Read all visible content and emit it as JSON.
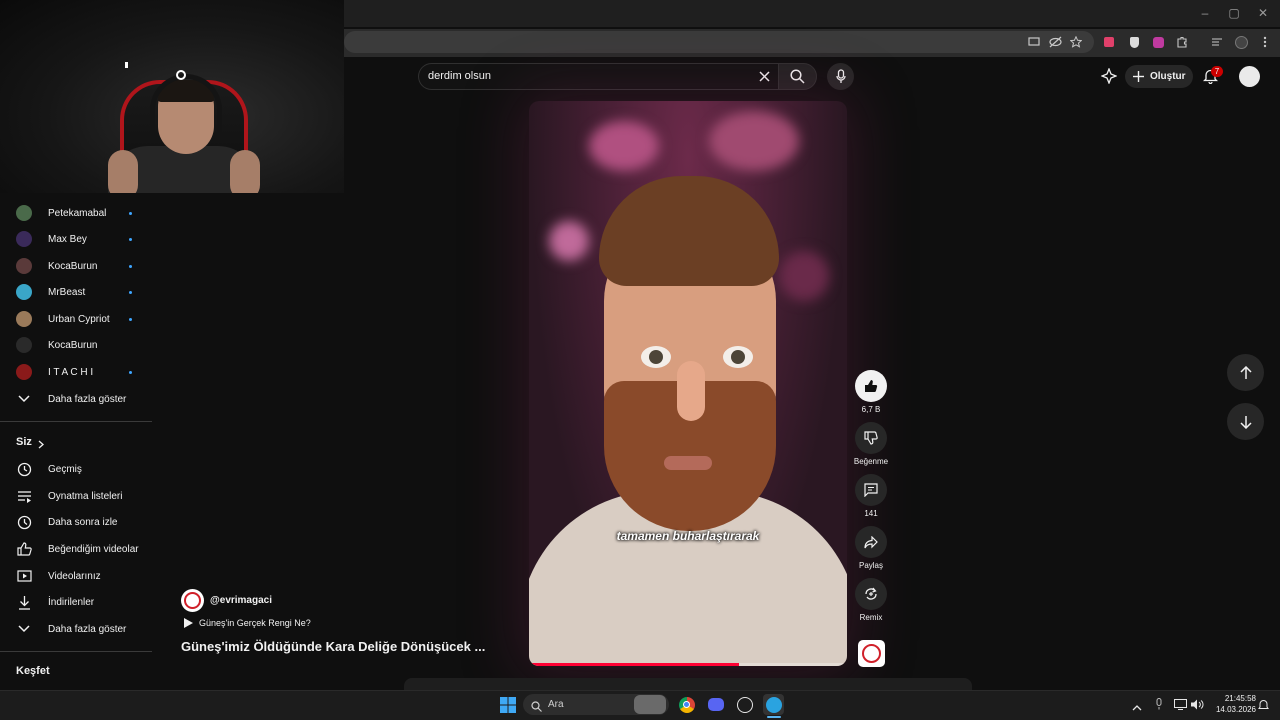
{
  "search": {
    "query": "derdim olsun"
  },
  "header": {
    "create_label": "Oluştur",
    "notification_count": "7"
  },
  "sidebar": {
    "subscriptions": [
      {
        "name": "Petekamabal",
        "avatar_color": "#4a6a4a",
        "new": true
      },
      {
        "name": "Max Bey",
        "avatar_color": "#3a2a5a",
        "new": true
      },
      {
        "name": "KocaBurun",
        "avatar_color": "#5a3a3a",
        "new": true
      },
      {
        "name": "MrBeast",
        "avatar_color": "#3aa6c8",
        "new": true
      },
      {
        "name": "Urban Cypriot",
        "avatar_color": "#9a7a5a",
        "new": true
      },
      {
        "name": "KocaBurun",
        "avatar_color": "#2a2a2a",
        "new": false
      },
      {
        "name": "I T A C H I",
        "avatar_color": "#8a1a1a",
        "new": true
      }
    ],
    "show_more_1": "Daha fazla göster",
    "you_section": "Siz",
    "you_items": [
      {
        "label": "Geçmiş",
        "icon": "history-icon"
      },
      {
        "label": "Oynatma listeleri",
        "icon": "playlists-icon"
      },
      {
        "label": "Daha sonra izle",
        "icon": "watch-later-icon"
      },
      {
        "label": "Beğendiğim videolar",
        "icon": "liked-icon"
      },
      {
        "label": "Videolarınız",
        "icon": "your-videos-icon"
      },
      {
        "label": "İndirilenler",
        "icon": "downloads-icon"
      }
    ],
    "show_more_2": "Daha fazla göster",
    "explore": "Keşfet"
  },
  "video": {
    "caption": "tamamen buharlaştırarak",
    "progress": 0.66,
    "channel": "@evrimagaci",
    "playlist": "Güneş'in Gerçek Rengi Ne?",
    "title": "Güneş'imiz Öldüğünde Kara Deliğe Dönüşücek ..."
  },
  "actions": {
    "likes": "6,7 B",
    "dislike": "Beğenme",
    "comments": "141",
    "share": "Paylaş",
    "remix": "Remix"
  },
  "taskbar": {
    "search_placeholder": "Ara",
    "time": "21:45:58",
    "date": "14.03.2026"
  },
  "colors": {
    "accent": "#ff0033",
    "subscription_dot": "#3ea6ff"
  }
}
